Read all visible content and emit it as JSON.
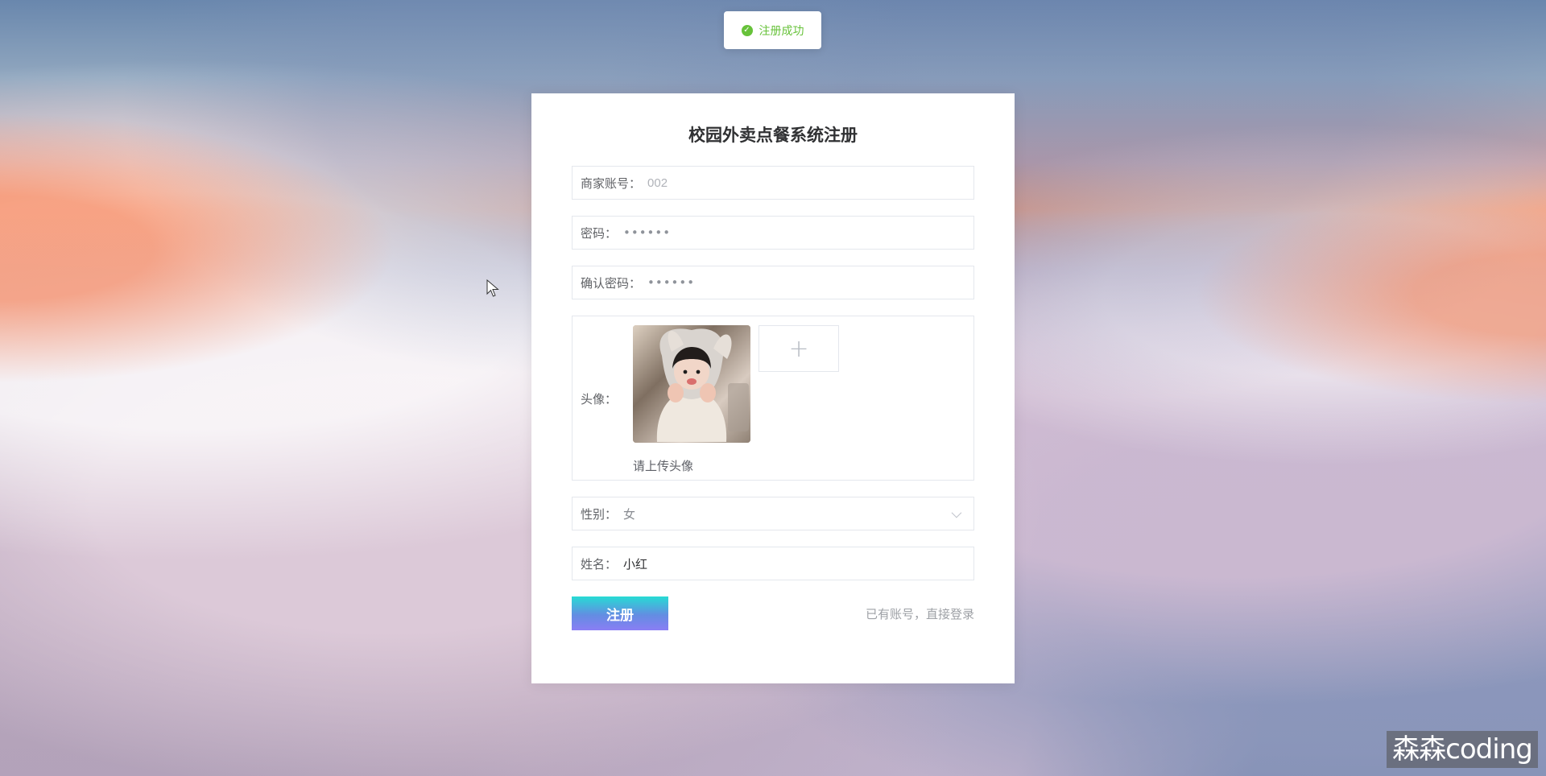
{
  "toast": {
    "icon": "check-circle-icon",
    "text": "注册成功"
  },
  "form": {
    "title": "校园外卖点餐系统注册",
    "account_label": "商家账号：",
    "account_placeholder": "002",
    "password_label": "密码：",
    "password_value": "••••••",
    "confirm_label": "确认密码：",
    "confirm_value": "••••••",
    "avatar_label": "头像：",
    "avatar_hint": "请上传头像",
    "upload_icon": "plus-icon",
    "gender_label": "性别：",
    "gender_value": "女",
    "gender_icon": "chevron-down-icon",
    "name_label": "姓名：",
    "name_value": "小红",
    "submit_label": "注册",
    "login_link": "已有账号，直接登录"
  },
  "watermark": {
    "text": "森森coding"
  },
  "colors": {
    "success": "#67c23a",
    "button_gradient_start": "#27dbd4",
    "button_gradient_end": "#8a7ef4"
  }
}
